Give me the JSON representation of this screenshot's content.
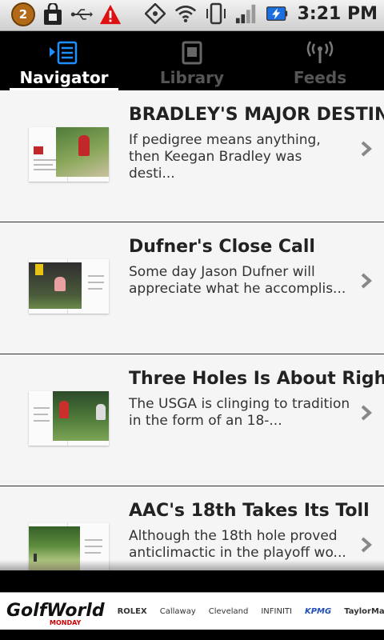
{
  "status": {
    "badge_count": "2",
    "time": "3:21 PM"
  },
  "tabs": [
    {
      "label": "Navigator",
      "active": true
    },
    {
      "label": "Library",
      "active": false
    },
    {
      "label": "Feeds",
      "active": false
    }
  ],
  "articles": [
    {
      "title": "BRADLEY'S MAJOR DESTINY",
      "summary": " If pedigree means anything, then Keegan Bradley was desti..."
    },
    {
      "title": "Dufner's Close Call",
      "summary": " Some day Jason Dufner will appreciate what he accomplis..."
    },
    {
      "title": "Three Holes Is About Right",
      "summary": " The USGA is clinging to tradition in the form of an 18-..."
    },
    {
      "title": "AAC's 18th Takes Its Toll",
      "summary": " Although the 18th hole proved anticlimactic in the playoff wo..."
    }
  ],
  "banner": {
    "brand": "GolfWorld",
    "brand_sub": "MONDAY",
    "sponsors": [
      "ROLEX",
      "Callaway",
      "Cleveland",
      "INFINITI",
      "KPMG",
      "TaylorMade"
    ]
  },
  "colors": {
    "active_tab": "#ffffff",
    "inactive_tab": "#555555",
    "list_bg": "#f5f5f5",
    "divider": "#333333"
  }
}
